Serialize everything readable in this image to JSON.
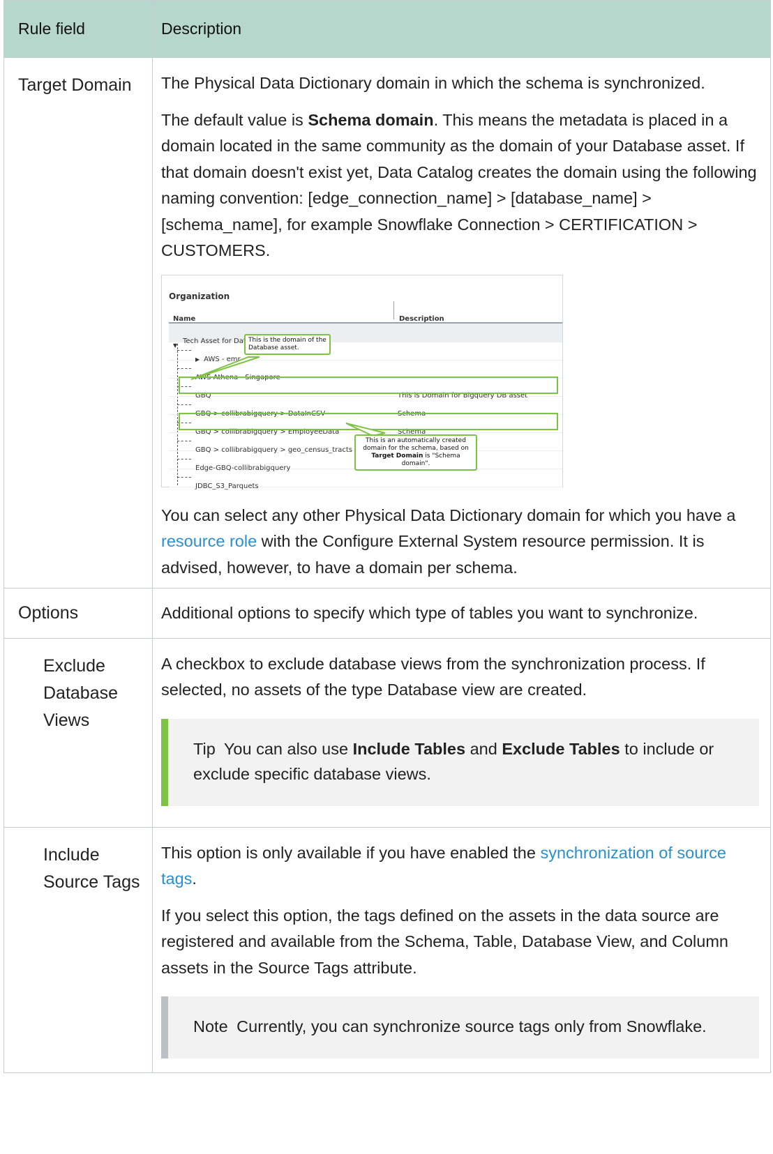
{
  "header": {
    "col_field": "Rule field",
    "col_desc": "Description"
  },
  "rows": {
    "target": {
      "field": "Target Domain",
      "p1": "The Physical Data Dictionary domain in which the schema is synchronized.",
      "p2_pre": "The default value is ",
      "p2_bold": "Schema domain",
      "p2_post": ". This means the metadata is placed in a domain located in the same community as the domain of your Database asset. If that domain doesn't exist yet, Data Catalog creates the domain using the following naming convention: [edge_connection_name] > [database_name] > [schema_name], for example Snowflake Connection > CERTIFICATION > CUSTOMERS.",
      "p3_pre": "You can select any other Physical Data Dictionary domain for which you have a ",
      "p3_link": "resource role",
      "p3_post": " with the Configure External System resource permission. It is advised, however, to have a domain per schema."
    },
    "options": {
      "field": "Options",
      "desc": "Additional options to specify which type of tables you want to synchronize."
    },
    "exclude_views": {
      "field": "Exclude Database Views",
      "desc": "A checkbox to exclude database views from the synchronization process. If selected, no assets of the type Database view are created.",
      "tip_label": "Tip",
      "tip_pre": "You can also use ",
      "tip_bold1": "Include Tables",
      "tip_mid": " and ",
      "tip_bold2": "Exclude Tables",
      "tip_post": " to include or exclude specific database views."
    },
    "source_tags": {
      "field": "Include Source Tags",
      "p1_pre": "This option is only available if you have enabled the ",
      "p1_link": "synchronization of source tags",
      "p1_post": ".",
      "p2": "If you select this option, the tags defined on the assets in the data source are registered and available from the Schema, Table, Database View, and Column assets in the Source Tags attribute.",
      "note_label": "Note",
      "note_text": "Currently, you can synchronize source tags only from Snowflake."
    }
  },
  "figure": {
    "title": "Organization",
    "col_name": "Name",
    "col_desc": "Description",
    "rows": [
      {
        "name": "Tech Asset for Data Source ingestions",
        "desc": ""
      },
      {
        "name": "AWS - emr",
        "desc": ""
      },
      {
        "name": "AWS Athena - Singapore",
        "desc": ""
      },
      {
        "name": "GBQ",
        "desc": "This is Domain for Bigquery DB asset"
      },
      {
        "name": "GBQ > collibrabigquery > DataInCSV",
        "desc": "Schema"
      },
      {
        "name": "GBQ > collibrabigquery > EmployeeData",
        "desc": "Schema"
      },
      {
        "name": "GBQ > collibrabigquery > geo_census_tracts",
        "desc": ""
      },
      {
        "name": "Edge-GBQ-collibrabigquery",
        "desc": ""
      },
      {
        "name": "JDBC_S3_Parquets",
        "desc": ""
      }
    ],
    "callout1": "This is the domain of the Database asset.",
    "callout2_pre": "This is an automatically created domain for the schema, based on ",
    "callout2_bold": "Target Domain",
    "callout2_post": " is \"Schema domain\".",
    "accent": "#7dc243"
  },
  "colors": {
    "header_bg": "#b6d7cc",
    "link": "#2a8fcd",
    "tip_bar": "#7dc243",
    "note_bar": "#b9c0c6"
  }
}
